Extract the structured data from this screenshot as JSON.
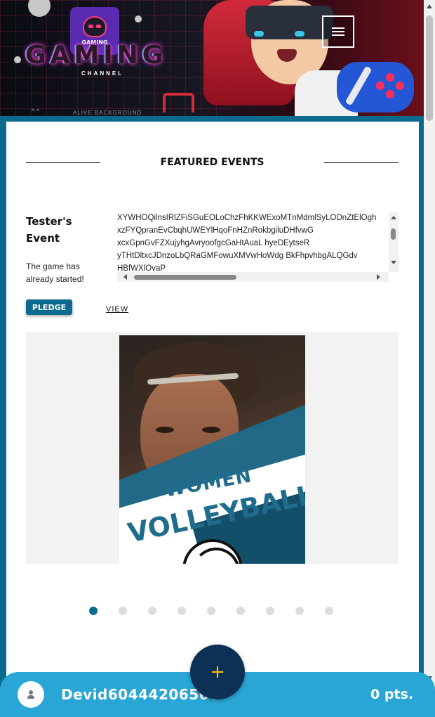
{
  "header": {
    "logo_label": "GAMING",
    "brand_title": "GAMING",
    "brand_subtitle": "CHANNEL",
    "faint_text": "ALIVE BACKGROUND",
    "faint_arrows": "^ ^",
    "menu_icon": "hamburger-menu-icon"
  },
  "featured": {
    "title": "FEATURED EVENTS"
  },
  "event": {
    "title": "Tester's Event",
    "status": "The game has already started!",
    "description_lines": [
      "XYWHOQilnsIRlZFiSGuEOLoChzFhKKWExoMTnMdmlSyLODnZtElOgh",
      "xzFYQpranEvCbqhUWEYlHqoFnHZnRokbgiluDHfvwG",
      "xcxGpnGvFZXujyhgAvryoofgcGaHtAuaL hyeDEytseR",
      "yTHtDltxcJDnzoLbQRaGMFowuXMVwHoWdg BkFhpvhbgALQGdv",
      "HBfWXlOvaP"
    ],
    "pledge_label": "PLEDGE",
    "view_label": "VIEW"
  },
  "slider": {
    "poster_line1": "WOMEN",
    "poster_line2": "VOLLEYBALL",
    "dot_count": 9,
    "active_index": 0
  },
  "bottom_bar": {
    "username": "Devid60444206566",
    "points": "0 pts.",
    "avatar_icon": "user-icon",
    "fab_label": "+"
  },
  "colors": {
    "primary": "#0b6b8f",
    "bottom_bar": "#2aa6d6",
    "fab": "#0d3154",
    "fab_icon": "#f2c200"
  }
}
